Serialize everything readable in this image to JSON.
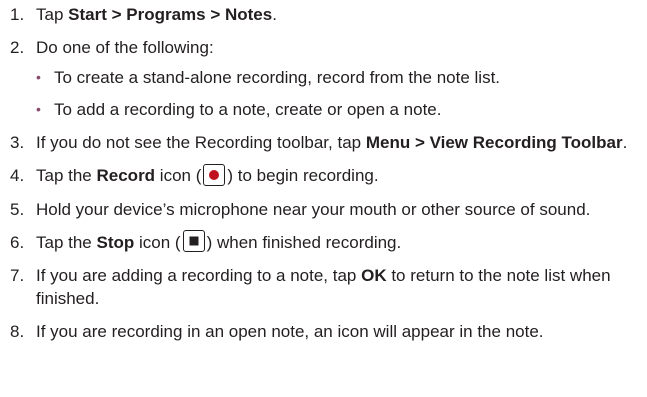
{
  "steps": [
    {
      "number": "1.",
      "pre": "Tap ",
      "bold": "Start > Programs > Notes",
      "post": "."
    },
    {
      "number": "2.",
      "text": "Do one of the following:",
      "bullets": [
        "To create a stand-alone recording, record from the note list.",
        "To add a recording to a note, create or open a note."
      ]
    },
    {
      "number": "3.",
      "pre": "If you do not see the Recording toolbar, tap ",
      "bold": "Menu > View Recording Toolbar",
      "post": "."
    },
    {
      "number": "4.",
      "pre": "Tap the ",
      "bold": "Record",
      "mid_open": " icon (",
      "icon": "record-icon",
      "mid_close": ") to begin recording."
    },
    {
      "number": "5.",
      "text": "Hold your device’s microphone near your mouth or other source of sound."
    },
    {
      "number": "6.",
      "pre": "Tap the ",
      "bold": "Stop",
      "mid_open": " icon (",
      "icon": "stop-icon",
      "mid_close": ") when finished recording."
    },
    {
      "number": "7.",
      "pre": "If you are adding a recording to a note, tap ",
      "bold": "OK",
      "post": " to return to the note list when finished."
    },
    {
      "number": "8.",
      "text": "If you are recording in an open note, an icon will appear in the note."
    }
  ],
  "bullet_glyph": "•",
  "colors": {
    "text": "#231f20",
    "bullet": "#8a4a6e",
    "record_dot": "#c0121e"
  }
}
